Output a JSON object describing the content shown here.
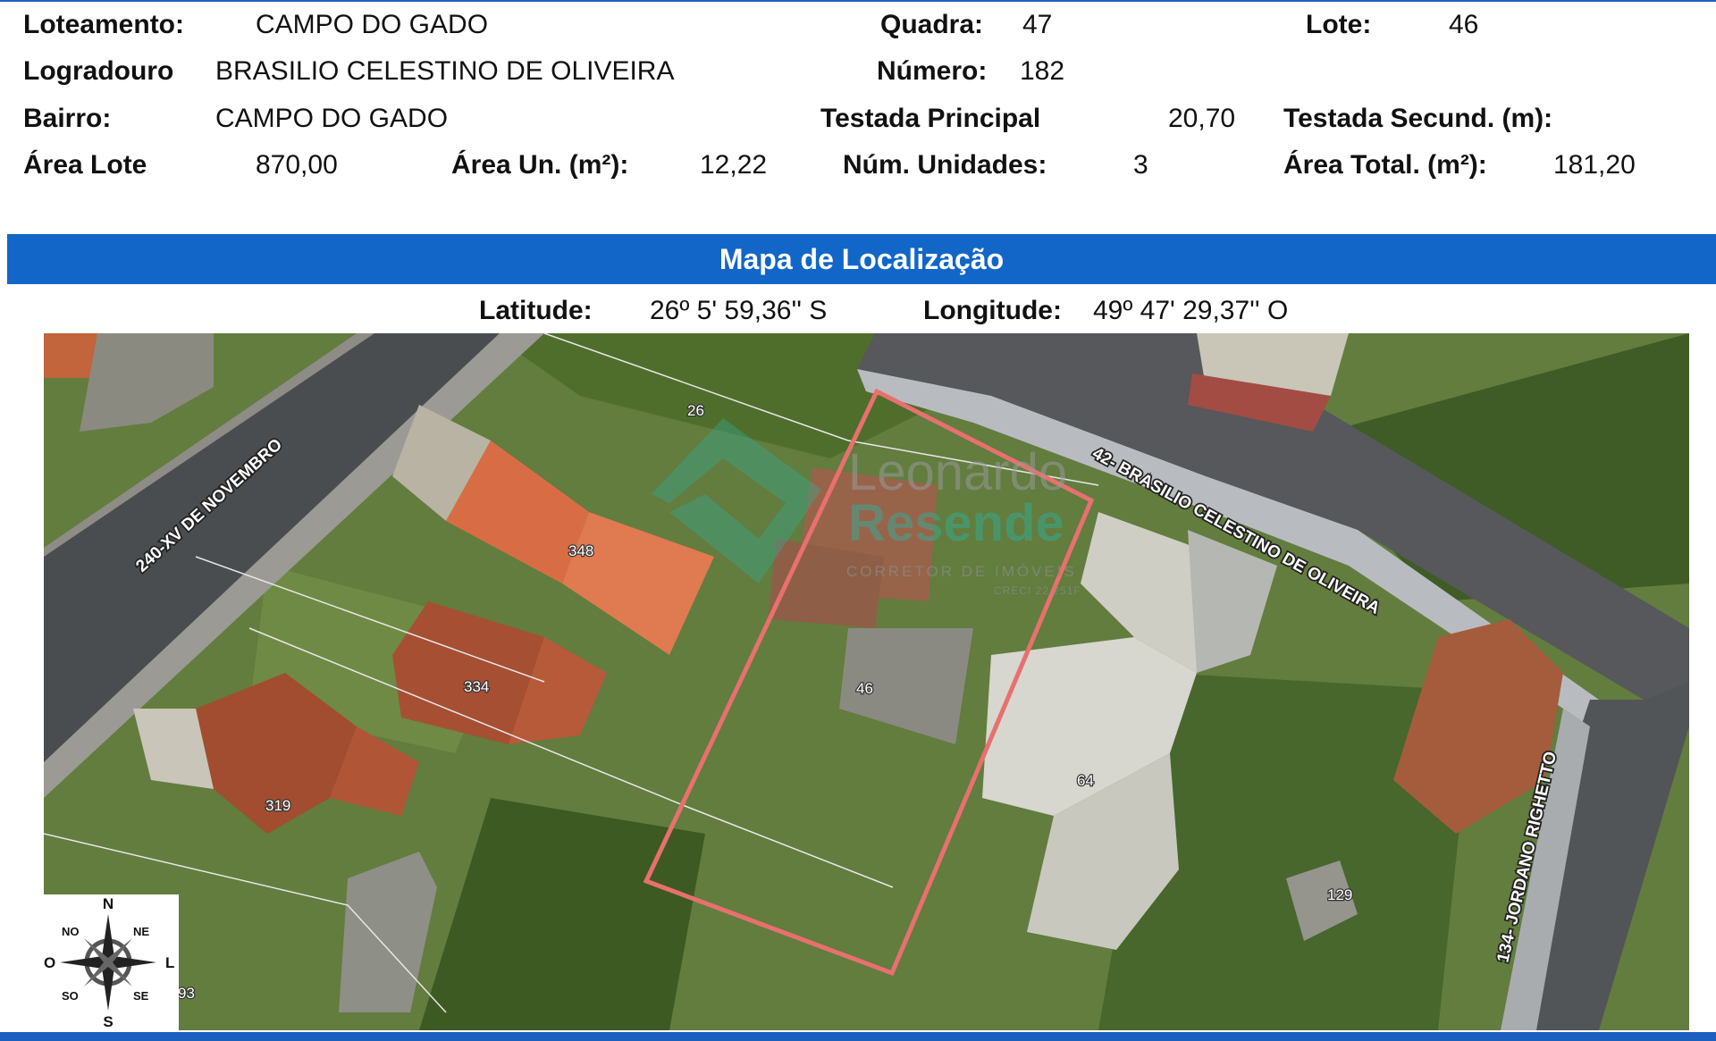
{
  "header": {
    "loteamento_label": "Loteamento:",
    "loteamento_value": "CAMPO DO GADO",
    "quadra_label": "Quadra:",
    "quadra_value": "47",
    "lote_label": "Lote:",
    "lote_value": "46",
    "logradouro_label": "Logradouro",
    "logradouro_value": "BRASILIO CELESTINO DE OLIVEIRA",
    "numero_label": "Número:",
    "numero_value": "182",
    "bairro_label": "Bairro:",
    "bairro_value": "CAMPO DO GADO",
    "testada_principal_label": "Testada Principal",
    "testada_principal_value": "20,70",
    "testada_secund_label": "Testada Secund. (m):",
    "area_lote_label": "Área Lote",
    "area_lote_value": "870,00",
    "area_un_label": "Área Un. (m²):",
    "area_un_value": "12,22",
    "num_unidades_label": "Núm. Unidades:",
    "num_unidades_value": "3",
    "area_total_label": "Área Total. (m²):",
    "area_total_value": "181,20"
  },
  "map_section": {
    "title": "Mapa de Localização",
    "latitude_label": "Latitude:",
    "latitude_value": "26º 5' 59,36'' S",
    "longitude_label": "Longitude:",
    "longitude_value": "49º 47' 29,37'' O"
  },
  "map": {
    "streets": {
      "xv_novembro": "240-XV DE NOVEMBRO",
      "brasilio": "42- BRASILIO CELESTINO DE OLIVEIRA",
      "jordano": "134- JORDANO RIGHETTO"
    },
    "lot_numbers": {
      "n26": "26",
      "n348": "348",
      "n334": "334",
      "n319": "319",
      "n46": "46",
      "n64": "64",
      "n129": "129",
      "n93": "93"
    },
    "watermark": {
      "line1": "Leonardo",
      "line2": "Resende",
      "line3": "CORRETOR DE IMÓVEIS",
      "line4": "CRECI 22.251F"
    },
    "highlight_color": "#e8706e"
  },
  "compass": {
    "n": "N",
    "s": "S",
    "o": "O",
    "l": "L",
    "no": "NO",
    "ne": "NE",
    "so": "SO",
    "se": "SE"
  }
}
